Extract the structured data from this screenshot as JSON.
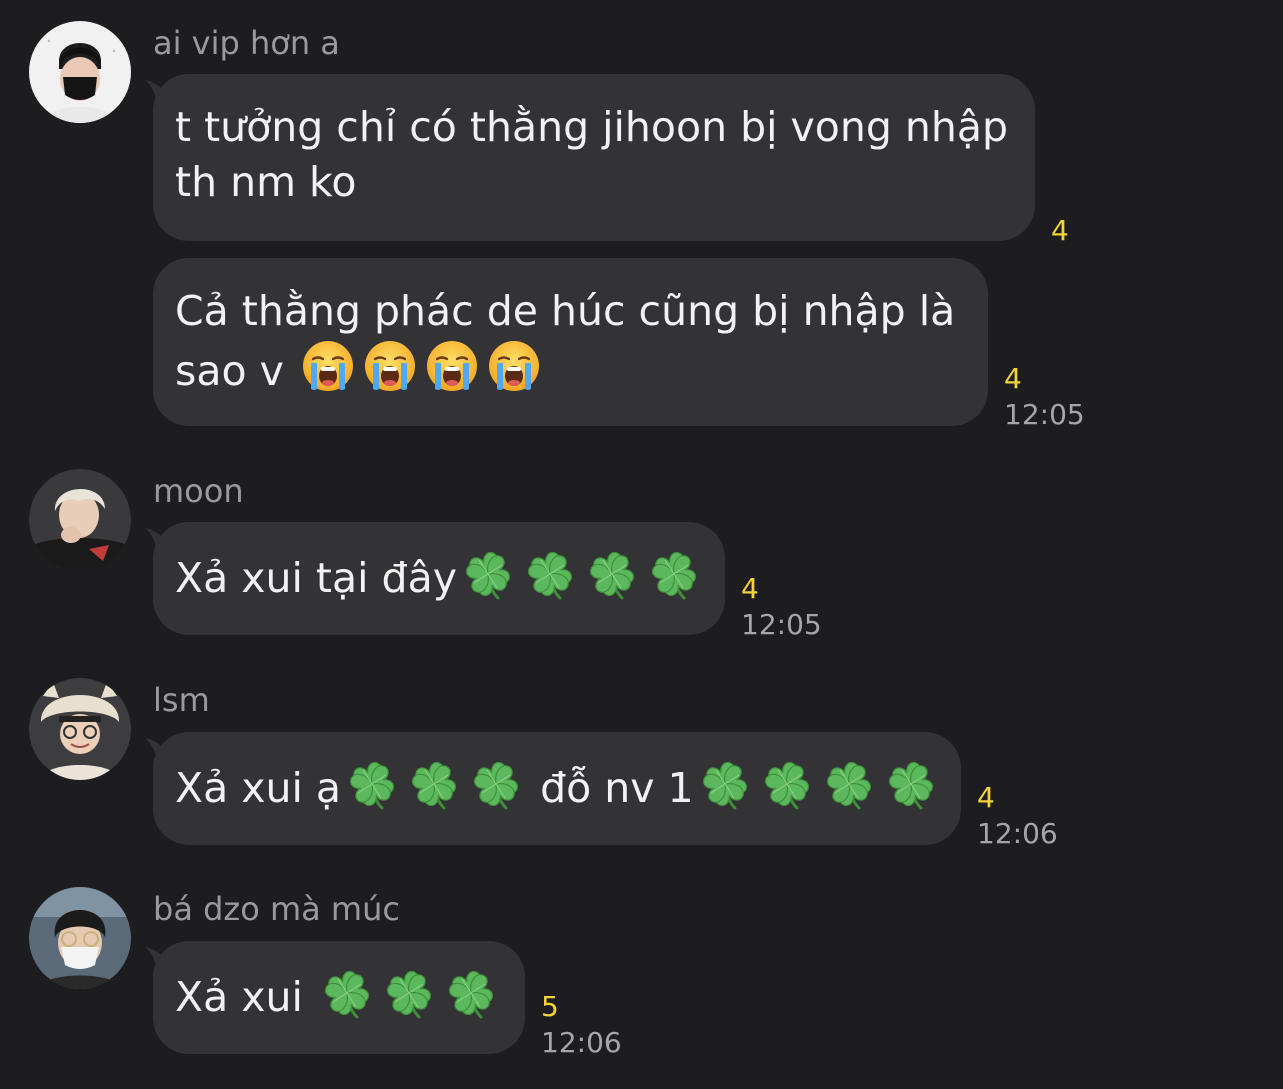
{
  "colors": {
    "background": "#1d1d1f",
    "bubble": "#333335",
    "message_text": "#f2f2f4",
    "sender_name": "#9a9a9e",
    "read_count": "#f2d33a",
    "timestamp": "#a6a6aa",
    "clover": "#5cb85c"
  },
  "messages": [
    {
      "sender": "ai vip hơn a",
      "avatar": "avatar-masked-user",
      "bubbles": [
        {
          "line1": "t tưởng chỉ có thằng jihoon bị vong nhập",
          "line2": "th nm ko",
          "reads": "4",
          "time": ""
        },
        {
          "line1": "Cả thằng phác de húc cũng bị nhập là",
          "line2_text": "sao v",
          "line2_emoji": "loudly-crying-face-icon",
          "line2_emoji_count": 4,
          "reads": "4",
          "time": "12:05"
        }
      ]
    },
    {
      "sender": "moon",
      "avatar": "avatar-blond-user",
      "bubbles": [
        {
          "text": "Xả xui tại đây",
          "emoji": "four-leaf-clover-icon",
          "emoji_count": 4,
          "reads": "4",
          "time": "12:05"
        }
      ]
    },
    {
      "sender": "lsm",
      "avatar": "avatar-hat-user",
      "bubbles": [
        {
          "text_a": "Xả xui ạ",
          "emoji_a_count": 3,
          "text_b": "đỗ nv 1",
          "emoji_b_count": 4,
          "emoji": "four-leaf-clover-icon",
          "reads": "4",
          "time": "12:06"
        }
      ]
    },
    {
      "sender": "bá dzo mà múc",
      "avatar": "avatar-mask-glasses-user",
      "bubbles": [
        {
          "text": "Xả xui",
          "emoji": "four-leaf-clover-icon",
          "emoji_count": 3,
          "reads": "5",
          "time": "12:06"
        }
      ]
    }
  ]
}
